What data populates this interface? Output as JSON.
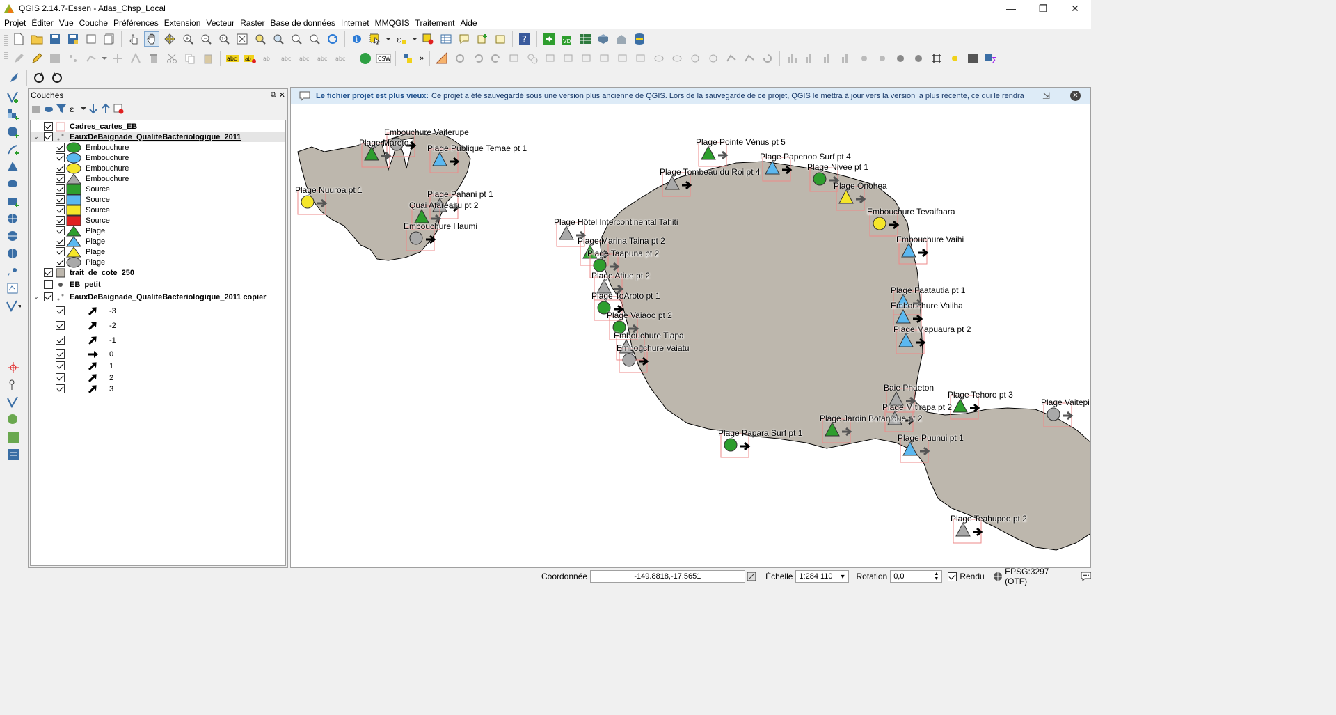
{
  "window": {
    "title": "QGIS 2.14.7-Essen - Atlas_Chsp_Local",
    "minimize": "—",
    "maximize": "❐",
    "close": "✕"
  },
  "menu": [
    "Projet",
    "Éditer",
    "Vue",
    "Couche",
    "Préférences",
    "Extension",
    "Vecteur",
    "Raster",
    "Base de données",
    "Internet",
    "MMQGIS",
    "Traitement",
    "Aide"
  ],
  "layers_panel": {
    "title": "Couches",
    "float": "⧉",
    "close": "✕",
    "layers": [
      {
        "label": "Cadres_cartes_EB",
        "checked": true,
        "bold": true
      },
      {
        "label": "EauxDeBaignade_QualiteBacteriologique_2011",
        "checked": true,
        "bold": true,
        "underline": true,
        "expanded": true
      },
      {
        "label": "Embouchure",
        "sym": "circle",
        "color": "#2e9e2e"
      },
      {
        "label": "Embouchure",
        "sym": "circle",
        "color": "#5bb8f0"
      },
      {
        "label": "Embouchure",
        "sym": "circle",
        "color": "#f5e62a"
      },
      {
        "label": "Embouchure",
        "sym": "triangle",
        "color": "#a9a9a9"
      },
      {
        "label": "Source",
        "sym": "square",
        "color": "#2e9e2e"
      },
      {
        "label": "Source",
        "sym": "square",
        "color": "#5bb8f0"
      },
      {
        "label": "Source",
        "sym": "square",
        "color": "#f5e62a"
      },
      {
        "label": "Source",
        "sym": "square",
        "color": "#e02020"
      },
      {
        "label": "Plage",
        "sym": "triangle",
        "color": "#2e9e2e"
      },
      {
        "label": "Plage",
        "sym": "triangle",
        "color": "#5bb8f0"
      },
      {
        "label": "Plage",
        "sym": "triangle",
        "color": "#f5e62a"
      },
      {
        "label": "Plage",
        "sym": "circle",
        "color": "#a9a9a9"
      },
      {
        "label": "trait_de_cote_250",
        "checked": true,
        "bold": true
      },
      {
        "label": "EB_petit",
        "checked": false,
        "bold": true
      },
      {
        "label": "EauxDeBaignade_QualiteBacteriologique_2011 copier",
        "checked": true,
        "bold": true,
        "expanded": true
      },
      {
        "label": "-3"
      },
      {
        "label": "-2"
      },
      {
        "label": "-1"
      },
      {
        "label": "0"
      },
      {
        "label": "1"
      },
      {
        "label": "2"
      },
      {
        "label": "3"
      }
    ]
  },
  "message_bar": {
    "lead": "Le fichier projet est plus vieux:",
    "text": "Ce projet a été sauvegardé sous une version plus ancienne de QGIS. Lors de la sauvegarde de ce projet, QGIS le mettra à jour vers la version la plus récente, ce qui le rendra"
  },
  "map_labels": [
    "Embouchure Vaiterupe",
    "Plage Mareto",
    "Plage Publique Temae pt 1",
    "Plage Nuuroa  pt 1",
    "Plage Pahani pt 1",
    "Quai Afareaitu pt 2",
    "Embouchure Haumi",
    "Plage Pointe Vénus pt 5",
    "Plage Papenoo Surf pt 4",
    "Plage Nivee pt 1",
    "Plage Tombeau du Roi pt 4",
    "Plage Onohea",
    "Embouchure Tevaifaara",
    "Plage Hôtel Intercontinental Tahiti",
    "Plage Marina Taina pt 2",
    "Plage Taapuna pt 2",
    "Embouchure Vaihi",
    "Plage Atiue pt 2",
    "Plage ToAroto pt 1",
    "Plage Faatautia pt 1",
    "Embouchure Vaiiha",
    "Plage Vaiaoo pt 2",
    "Plage Mapuaura pt 2",
    "Embouchure Tiapa",
    "Embouchure Vaiatu",
    "Baie Phaeton",
    "Plage Tehoro pt 3",
    "Plage Vaitepiha",
    "Plage Mitirapa pt 2",
    "Plage Jardin Botanique pt 2",
    "Plage Papara Surf pt 1",
    "Plage Puunui pt 1",
    "Plage Teahupoo pt 2"
  ],
  "status": {
    "coord_label": "Coordonnée",
    "coord_value": "-149.8818,-17.5651",
    "scale_label": "Échelle",
    "scale_value": "1:284 110",
    "rotation_label": "Rotation",
    "rotation_value": "0,0",
    "render_label": "Rendu",
    "render_checked": true,
    "crs": "EPSG:3297 (OTF)"
  }
}
